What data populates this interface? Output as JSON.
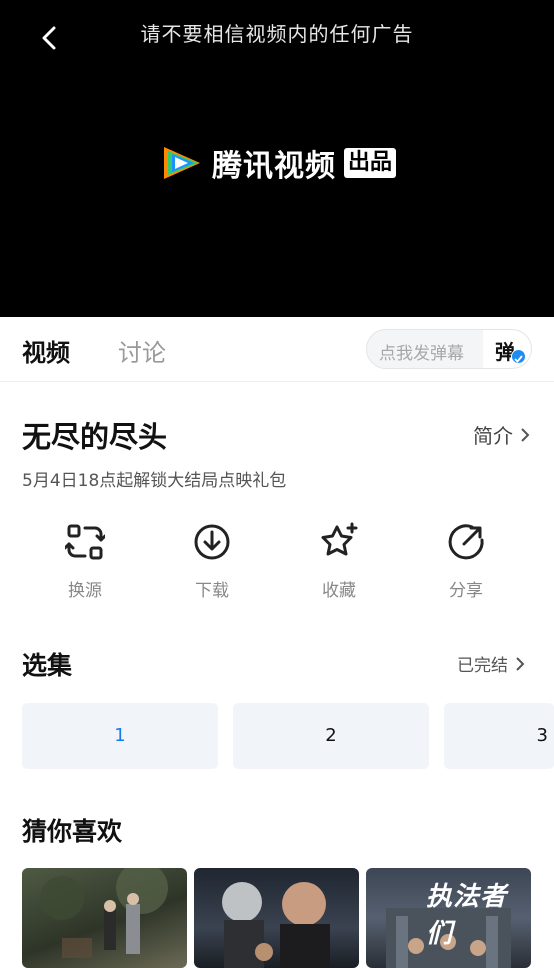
{
  "player": {
    "notice": "请不要相信视频内的任何广告",
    "brand_name": "腾讯视频",
    "brand_tag": "出品",
    "back_icon": "back-arrow-icon"
  },
  "tabs": [
    {
      "label": "视频",
      "active": true
    },
    {
      "label": "讨论",
      "active": false
    }
  ],
  "danmu": {
    "placeholder": "点我发弹幕",
    "toggle_label": "弹"
  },
  "show": {
    "title": "无尽的尽头",
    "intro_label": "简介",
    "subtitle": "5月4日18点起解锁大结局点映礼包"
  },
  "actions": [
    {
      "label": "换源",
      "icon": "switch-source-icon"
    },
    {
      "label": "下载",
      "icon": "download-icon"
    },
    {
      "label": "收藏",
      "icon": "favorite-star-icon"
    },
    {
      "label": "分享",
      "icon": "share-icon"
    }
  ],
  "episodes_section": {
    "title": "选集",
    "status": "已完结",
    "episodes": [
      "1",
      "2",
      "3"
    ],
    "active_index": 0
  },
  "recommend": {
    "title": "猜你喜欢",
    "posters": [
      {
        "caption": ""
      },
      {
        "caption": ""
      },
      {
        "caption": "执法者们"
      }
    ]
  },
  "colors": {
    "accent": "#1a7ce8",
    "player_bg": "#000000",
    "episode_bg": "#f1f4f9"
  }
}
